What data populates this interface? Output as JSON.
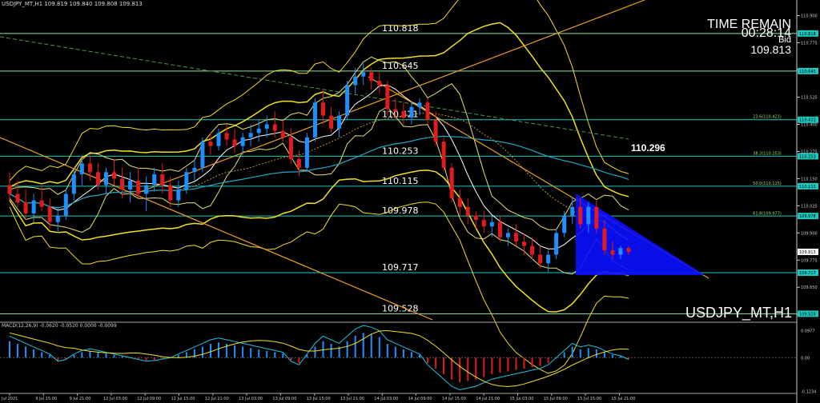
{
  "header": {
    "info": "USDJPY_MT,H1  109.819 109.840 109.808 109.813"
  },
  "hud": {
    "time_remain_label": "TIME REMAIN",
    "time_remain_value": "00:28:14",
    "bid_label": "Bid",
    "bid_value": "109.813"
  },
  "symbol_label": "USDJPY_MT,H1",
  "highlight_price": "110.296",
  "macd_label": "MACD(12,26,9) -0.0620 -0.0520 0.0000 -0.0099",
  "colors": {
    "bull": "#1e8fff",
    "bear": "#e21b1b",
    "level": "#19c9c0",
    "band": "#f0e020",
    "trend": "#f0a020",
    "triangle": "#0a10ff"
  },
  "chart_data": [
    {
      "type": "candlestick",
      "title": "USDJPY_MT,H1",
      "ylim": [
        109.5,
        110.95
      ],
      "y_ticks": [
        "110.900",
        "110.775",
        "110.650",
        "110.525",
        "110.400",
        "110.275",
        "110.150",
        "110.025",
        "109.900",
        "109.775",
        "109.650",
        "109.525"
      ],
      "x_ticks": [
        "Jul 2021",
        "9 Jul 15:00",
        "9 Jul 21:00",
        "12 Jul 03:00",
        "12 Jul 09:00",
        "12 Jul 15:00",
        "12 Jul 21:00",
        "13 Jul 03:00",
        "13 Jul 09:00",
        "13 Jul 15:00",
        "13 Jul 21:00",
        "14 Jul 03:00",
        "14 Jul 09:00",
        "14 Jul 15:00",
        "14 Jul 21:00",
        "15 Jul 03:00",
        "15 Jul 09:00",
        "15 Jul 15:00",
        "15 Jul 21:00"
      ],
      "levels": [
        {
          "label": "110.818",
          "value": 110.818
        },
        {
          "label": "110.645",
          "value": 110.645
        },
        {
          "label": "110.421",
          "value": 110.421
        },
        {
          "label": "110.253",
          "value": 110.253
        },
        {
          "label": "110.115",
          "value": 110.115
        },
        {
          "label": "109.978",
          "value": 109.978
        },
        {
          "label": "109.717",
          "value": 109.717
        },
        {
          "label": "109.528",
          "value": 109.528
        }
      ],
      "fib_labels": [
        "23.6(110.421)",
        "38.2(110.253)",
        "50.0(110.115)",
        "61.8(109.977)"
      ],
      "axis_price_tags": [
        "110.818",
        "110.645",
        "110.421",
        "110.253",
        "110.115",
        "109.978",
        "109.813",
        "109.717",
        "109.528"
      ],
      "candles": [
        [
          110.12,
          110.18,
          110.05,
          110.08
        ],
        [
          110.08,
          110.14,
          110.02,
          110.04
        ],
        [
          110.04,
          110.1,
          109.96,
          109.99
        ],
        [
          109.99,
          110.08,
          109.95,
          110.05
        ],
        [
          110.05,
          110.12,
          110.0,
          110.02
        ],
        [
          110.02,
          110.06,
          109.92,
          109.95
        ],
        [
          109.95,
          110.02,
          109.9,
          109.98
        ],
        [
          109.98,
          110.1,
          109.96,
          110.08
        ],
        [
          110.08,
          110.2,
          110.05,
          110.17
        ],
        [
          110.17,
          110.24,
          110.12,
          110.22
        ],
        [
          110.22,
          110.26,
          110.14,
          110.18
        ],
        [
          110.18,
          110.22,
          110.1,
          110.12
        ],
        [
          110.12,
          110.2,
          110.08,
          110.18
        ],
        [
          110.18,
          110.24,
          110.12,
          110.15
        ],
        [
          110.15,
          110.2,
          110.06,
          110.1
        ],
        [
          110.1,
          110.18,
          110.04,
          110.14
        ],
        [
          110.14,
          110.2,
          110.06,
          110.08
        ],
        [
          110.08,
          110.16,
          110.0,
          110.12
        ],
        [
          110.12,
          110.2,
          110.09,
          110.17
        ],
        [
          110.17,
          110.22,
          110.08,
          110.12
        ],
        [
          110.12,
          110.16,
          110.02,
          110.05
        ],
        [
          110.05,
          110.14,
          110.02,
          110.1
        ],
        [
          110.1,
          110.2,
          110.08,
          110.18
        ],
        [
          110.18,
          110.24,
          110.14,
          110.2
        ],
        [
          110.2,
          110.34,
          110.18,
          110.32
        ],
        [
          110.32,
          110.36,
          110.26,
          110.3
        ],
        [
          110.3,
          110.38,
          110.28,
          110.36
        ],
        [
          110.36,
          110.4,
          110.3,
          110.33
        ],
        [
          110.33,
          110.38,
          110.27,
          110.3
        ],
        [
          110.3,
          110.36,
          110.26,
          110.34
        ],
        [
          110.34,
          110.4,
          110.3,
          110.36
        ],
        [
          110.36,
          110.42,
          110.32,
          110.38
        ],
        [
          110.38,
          110.44,
          110.34,
          110.4
        ],
        [
          110.4,
          110.46,
          110.34,
          110.37
        ],
        [
          110.37,
          110.42,
          110.32,
          110.34
        ],
        [
          110.34,
          110.38,
          110.22,
          110.24
        ],
        [
          110.24,
          110.28,
          110.16,
          110.2
        ],
        [
          110.2,
          110.36,
          110.18,
          110.34
        ],
        [
          110.34,
          110.52,
          110.32,
          110.5
        ],
        [
          110.5,
          110.56,
          110.4,
          110.44
        ],
        [
          110.44,
          110.48,
          110.36,
          110.38
        ],
        [
          110.38,
          110.46,
          110.34,
          110.44
        ],
        [
          110.44,
          110.6,
          110.42,
          110.58
        ],
        [
          110.58,
          110.66,
          110.54,
          110.62
        ],
        [
          110.62,
          110.68,
          110.58,
          110.64
        ],
        [
          110.64,
          110.66,
          110.56,
          110.6
        ],
        [
          110.6,
          110.64,
          110.54,
          110.58
        ],
        [
          110.58,
          110.6,
          110.44,
          110.47
        ],
        [
          110.47,
          110.52,
          110.42,
          110.46
        ],
        [
          110.46,
          110.5,
          110.4,
          110.43
        ],
        [
          110.43,
          110.5,
          110.4,
          110.48
        ],
        [
          110.48,
          110.52,
          110.44,
          110.5
        ],
        [
          110.5,
          110.52,
          110.4,
          110.42
        ],
        [
          110.42,
          110.46,
          110.3,
          110.32
        ],
        [
          110.32,
          110.34,
          110.18,
          110.2
        ],
        [
          110.2,
          110.22,
          110.04,
          110.06
        ],
        [
          110.06,
          110.1,
          109.98,
          110.02
        ],
        [
          110.02,
          110.06,
          109.94,
          109.98
        ],
        [
          109.98,
          110.0,
          109.92,
          109.96
        ],
        [
          109.96,
          110.0,
          109.9,
          109.93
        ],
        [
          109.93,
          109.98,
          109.88,
          109.95
        ],
        [
          109.95,
          109.98,
          109.86,
          109.88
        ],
        [
          109.88,
          109.92,
          109.84,
          109.9
        ],
        [
          109.9,
          109.94,
          109.84,
          109.86
        ],
        [
          109.86,
          109.9,
          109.8,
          109.84
        ],
        [
          109.84,
          109.88,
          109.78,
          109.8
        ],
        [
          109.8,
          109.84,
          109.74,
          109.76
        ],
        [
          109.76,
          109.82,
          109.72,
          109.8
        ],
        [
          109.8,
          109.92,
          109.78,
          109.9
        ],
        [
          109.9,
          110.0,
          109.88,
          109.98
        ],
        [
          109.98,
          110.06,
          109.94,
          110.02
        ],
        [
          110.02,
          110.06,
          109.92,
          109.94
        ],
        [
          109.94,
          110.04,
          109.9,
          110.02
        ],
        [
          110.02,
          110.05,
          109.9,
          109.92
        ],
        [
          109.92,
          109.96,
          109.8,
          109.82
        ],
        [
          109.82,
          109.86,
          109.78,
          109.8
        ],
        [
          109.8,
          109.84,
          109.78,
          109.83
        ],
        [
          109.83,
          109.84,
          109.8,
          109.813
        ]
      ],
      "macd_ylim": [
        -0.13,
        0.12
      ],
      "macd_ticks": [
        "0.0977",
        "0.00",
        "-0.1234"
      ],
      "macd_hist": [
        0.06,
        0.05,
        0.04,
        0.03,
        0.02,
        0.01,
        -0.01,
        -0.005,
        0.01,
        0.02,
        0.025,
        0.02,
        0.015,
        0.01,
        0.005,
        0.0,
        -0.005,
        -0.01,
        -0.008,
        -0.004,
        0.0,
        0.01,
        0.02,
        0.03,
        0.04,
        0.05,
        0.055,
        0.05,
        0.045,
        0.04,
        0.035,
        0.03,
        0.025,
        0.02,
        0.015,
        -0.01,
        -0.02,
        0.01,
        0.04,
        0.06,
        0.05,
        0.04,
        0.06,
        0.08,
        0.09,
        0.085,
        0.075,
        0.05,
        0.04,
        0.03,
        0.02,
        0.01,
        -0.02,
        -0.04,
        -0.06,
        -0.08,
        -0.09,
        -0.085,
        -0.08,
        -0.07,
        -0.06,
        -0.055,
        -0.05,
        -0.045,
        -0.04,
        -0.035,
        -0.03,
        -0.02,
        0.0,
        0.02,
        0.04,
        0.03,
        0.035,
        0.03,
        0.02,
        0.01,
        0.005,
        -0.005
      ]
    }
  ]
}
